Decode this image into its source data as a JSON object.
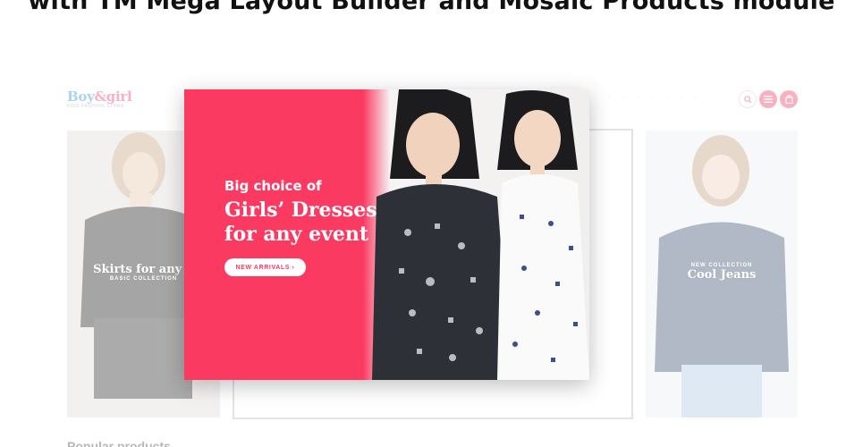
{
  "headline": "with TM Mega Layout Builder and Mosaic Products module",
  "site": {
    "logo_main_1": "Boy",
    "logo_amp": "&",
    "logo_main_2": "girl",
    "logo_sub": "KIDS FASHION STORE",
    "left_card": {
      "title": "Skirts for any d",
      "subtitle": "BASIC COLLECTION"
    },
    "right_card": {
      "subtitle": "NEW COLLECTION",
      "title": "Cool Jeans"
    },
    "popular_heading": "Popular products"
  },
  "banner": {
    "line1": "Big choice of",
    "line2": "Girls’ Dresses",
    "line3": "for any event",
    "button_label": "NEW ARRIVALS ›"
  },
  "colors": {
    "accent": "#fb3a62",
    "logo_blue": "#3a9bd9"
  }
}
